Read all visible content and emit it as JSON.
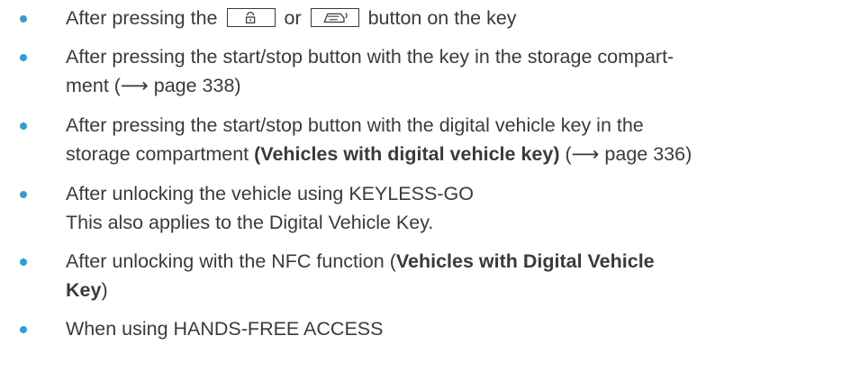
{
  "items": [
    {
      "before": "After pressing the",
      "middle": "or",
      "after": "button on the key",
      "icons": [
        "unlock-key-icon",
        "tailgate-key-icon"
      ]
    },
    {
      "line1": "After pressing the start/stop button with the key in the storage compart-",
      "line2_pre": "ment (",
      "arrow": "⟶",
      "line2_post": " page 338)"
    },
    {
      "line1": "After pressing the start/stop button with the digital vehicle key in the",
      "line2_pre": "storage compartment ",
      "line2_bold": "(Vehicles with digital vehicle key)",
      "line2_mid": " (",
      "arrow": "⟶",
      "line2_post": " page 336)"
    },
    {
      "line1": "After unlocking the vehicle using KEYLESS-GO",
      "line2": "This also applies to the Digital Vehicle Key."
    },
    {
      "pre": "After unlocking with the NFC function (",
      "bold1": "Vehicles with Digital Vehicle",
      "bold2": "Key",
      "post": ")"
    },
    {
      "text": "When using HANDS-FREE ACCESS"
    }
  ],
  "colors": {
    "bullet": "#2f9fd0",
    "text": "#3a3a3a"
  }
}
